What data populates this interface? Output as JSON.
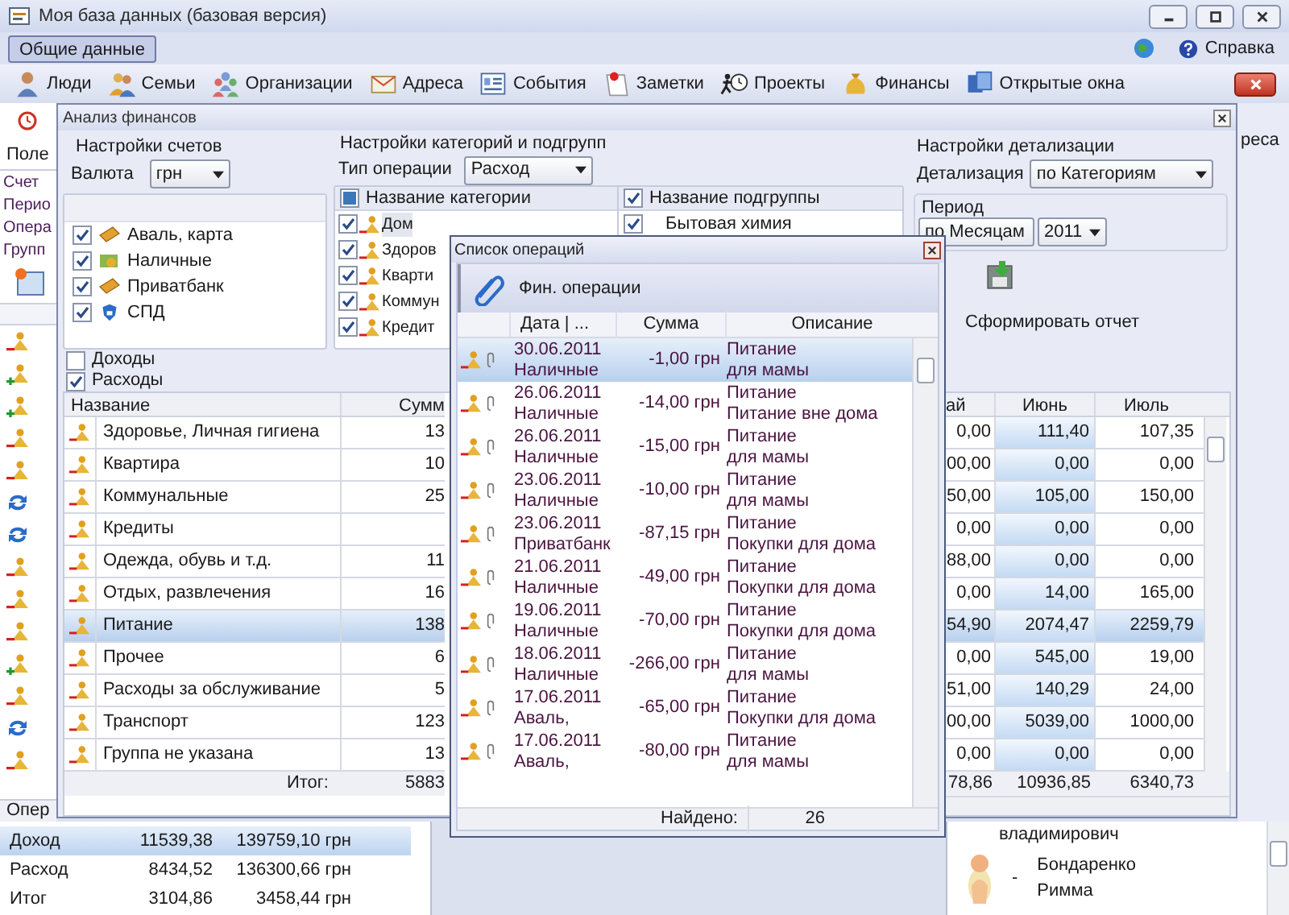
{
  "window": {
    "title": "Моя база данных (базовая версия)"
  },
  "menu": [
    {
      "label": "Общие данные",
      "selected": true
    }
  ],
  "help": {
    "label": "Справка"
  },
  "toolbar": [
    {
      "label": "Люди"
    },
    {
      "label": "Семьи"
    },
    {
      "label": "Организации"
    },
    {
      "label": "Адреса"
    },
    {
      "label": "События"
    },
    {
      "label": "Заметки"
    },
    {
      "label": "Проекты"
    },
    {
      "label": "Финансы"
    },
    {
      "label": "Открытые окна"
    }
  ],
  "side_panel": {
    "header": "Поле",
    "items": [
      "Счет",
      "Перио",
      "Опера",
      "Групп"
    ],
    "rows": [
      {
        "kind": "expense"
      },
      {
        "kind": "income"
      },
      {
        "kind": "income"
      },
      {
        "kind": "expense"
      },
      {
        "kind": "expense"
      },
      {
        "kind": "refresh"
      },
      {
        "kind": "refresh"
      },
      {
        "kind": "expense"
      },
      {
        "kind": "expense"
      },
      {
        "kind": "expense"
      },
      {
        "kind": "income"
      },
      {
        "kind": "expense"
      },
      {
        "kind": "refresh"
      },
      {
        "kind": "expense"
      }
    ],
    "footer": "Опер"
  },
  "right_strip": {
    "label": "реса"
  },
  "analysis": {
    "title": "Анализ финансов",
    "accounts": {
      "title": "Настройки счетов",
      "currency_label": "Валюта",
      "currency": "грн",
      "items": [
        {
          "name": "Аваль, карта",
          "kind": "card",
          "checked": true
        },
        {
          "name": "Наличные",
          "kind": "cash",
          "checked": true
        },
        {
          "name": "Приватбанк",
          "kind": "card",
          "checked": true
        },
        {
          "name": "СПД",
          "kind": "shield",
          "checked": true
        }
      ]
    },
    "categories": {
      "title": "Настройки категорий и подгрупп",
      "type_label": "Тип операции",
      "type": "Расход",
      "header": "Название категории",
      "header_indeterminate": true,
      "items": [
        {
          "name": "Дом",
          "checked": true,
          "selected": true
        },
        {
          "name": "Здоров",
          "checked": true,
          "selected": false
        },
        {
          "name": "Кварти",
          "checked": true,
          "selected": false
        },
        {
          "name": "Коммун",
          "checked": true,
          "selected": false
        },
        {
          "name": "Кредит",
          "checked": true,
          "selected": false
        }
      ],
      "sub_header": "Название подгруппы",
      "sub_header_checked": true,
      "sub_items": [
        {
          "name": "Бытовая химия",
          "checked": true
        }
      ]
    },
    "detail": {
      "title": "Настройки детализации",
      "label": "Детализация",
      "value": "по Категориям",
      "period_title": "Период",
      "period": "по Месяцам",
      "year": "2011",
      "report_button": "Сформировать отчет"
    },
    "filters": [
      {
        "label": "Доходы",
        "checked": false
      },
      {
        "label": "Расходы",
        "checked": true
      }
    ],
    "table": {
      "columns": [
        "Название",
        "Сумм",
        "ай",
        "Июнь",
        "Июль"
      ],
      "rows": [
        {
          "name": "Здоровье, Личная гигиена",
          "sum": "13",
          "may": "0,00",
          "june": "111,40",
          "july": "107,35",
          "selected": false
        },
        {
          "name": "Квартира",
          "sum": "10",
          "may": "00,00",
          "june": "0,00",
          "july": "0,00",
          "selected": false
        },
        {
          "name": "Коммунальные",
          "sum": "25",
          "may": "50,00",
          "june": "105,00",
          "july": "150,00",
          "selected": false
        },
        {
          "name": "Кредиты",
          "may": "0,00",
          "june": "0,00",
          "july": "0,00",
          "selected": false
        },
        {
          "name": "Одежда, обувь и т.д.",
          "sum": "11",
          "may": "88,00",
          "june": "0,00",
          "july": "0,00",
          "selected": false
        },
        {
          "name": "Отдых, развлечения",
          "sum": "16",
          "may": "0,00",
          "june": "14,00",
          "july": "165,00",
          "selected": false
        },
        {
          "name": "Питание",
          "sum": "138",
          "may": "54,90",
          "june": "2074,47",
          "july": "2259,79",
          "selected": true
        },
        {
          "name": "Прочее",
          "sum": "6",
          "may": "0,00",
          "june": "545,00",
          "july": "19,00",
          "selected": false
        },
        {
          "name": "Расходы за обслуживание",
          "sum": "5",
          "may": "51,00",
          "june": "140,29",
          "july": "24,00",
          "selected": false
        },
        {
          "name": "Транспорт",
          "sum": "123",
          "may": "00,00",
          "june": "5039,00",
          "july": "1000,00",
          "selected": false
        },
        {
          "name": "Группа не указана",
          "sum": "13",
          "may": "0,00",
          "june": "0,00",
          "july": "0,00",
          "selected": false
        }
      ],
      "total_label": "Итог:",
      "totals": [
        "5883",
        "78,86",
        "10936,85",
        "6340,73"
      ]
    }
  },
  "operations": {
    "title": "Список операций",
    "toolbar_label": "Фин. операции",
    "columns": [
      "Дата | ...",
      "Сумма",
      "Описание"
    ],
    "rows": [
      {
        "date": "30.06.2011",
        "account": "Наличные",
        "amount": "-1,00 грн",
        "category": "Питание",
        "subcategory": "для мамы",
        "selected": true
      },
      {
        "date": "26.06.2011",
        "account": "Наличные",
        "amount": "-14,00 грн",
        "category": "Питание",
        "subcategory": "Питание вне дома",
        "selected": false
      },
      {
        "date": "26.06.2011",
        "account": "Наличные",
        "amount": "-15,00 грн",
        "category": "Питание",
        "subcategory": "для мамы",
        "selected": false
      },
      {
        "date": "23.06.2011",
        "account": "Наличные",
        "amount": "-10,00 грн",
        "category": "Питание",
        "subcategory": "для мамы",
        "selected": false
      },
      {
        "date": "23.06.2011",
        "account": "Приватбанк",
        "amount": "-87,15 грн",
        "category": "Питание",
        "subcategory": "Покупки для дома",
        "selected": false
      },
      {
        "date": "21.06.2011",
        "account": "Наличные",
        "amount": "-49,00 грн",
        "category": "Питание",
        "subcategory": "Покупки для дома",
        "selected": false
      },
      {
        "date": "19.06.2011",
        "account": "Наличные",
        "amount": "-70,00 грн",
        "category": "Питание",
        "subcategory": "Покупки для дома",
        "selected": false
      },
      {
        "date": "18.06.2011",
        "account": "Наличные",
        "amount": "-266,00 грн",
        "category": "Питание",
        "subcategory": "для мамы",
        "selected": false
      },
      {
        "date": "17.06.2011",
        "account": "Аваль,",
        "amount": "-65,00 грн",
        "category": "Питание",
        "subcategory": "Покупки для дома",
        "selected": false
      },
      {
        "date": "17.06.2011",
        "account": "Аваль,",
        "amount": "-80,00 грн",
        "category": "Питание",
        "subcategory": "для мамы",
        "selected": false
      }
    ],
    "found_label": "Найдено:",
    "found": "26"
  },
  "summary": {
    "rows": [
      {
        "label": "Доход",
        "value_1": "11539,38",
        "value_2": "139759,10 грн",
        "selected": true
      },
      {
        "label": "Расход",
        "value_1": "8434,52",
        "value_2": "136300,66 грн",
        "selected": false
      },
      {
        "label": "Итог",
        "value_1": "3104,86",
        "value_2": "3458,44 грн",
        "selected": false
      }
    ]
  },
  "contacts": [
    {
      "lines": [
        "владимирович"
      ]
    },
    {
      "lines": [
        "Бондаренко",
        "Римма"
      ],
      "mark": "-"
    }
  ]
}
